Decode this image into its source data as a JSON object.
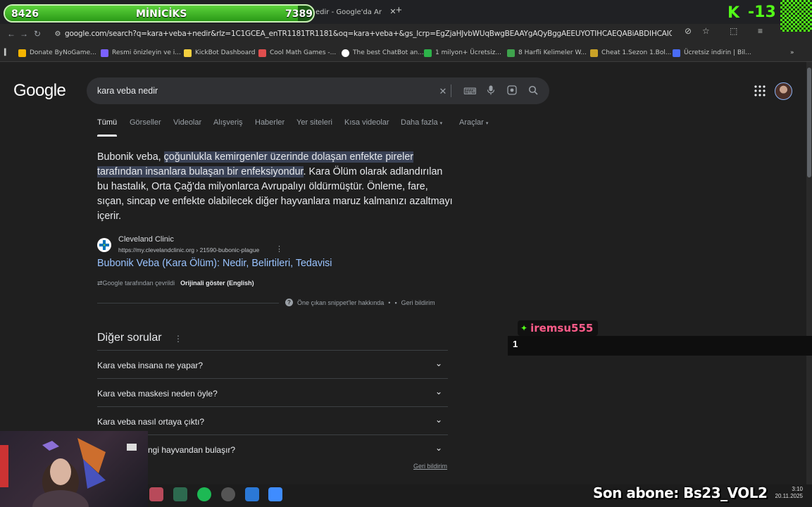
{
  "browser": {
    "tab_title": "edir - Google'da Ar",
    "url": "google.com/search?q=kara+veba+nedir&rlz=1C1GCEA_enTR1181TR1181&oq=kara+veba+&gs_lcrp=EgZjaHJvbWUqBwgBEAAYgAQyBggAEEUYOTIHCAEQABiABDIHCAIQABiABDIH...",
    "bookmarks": [
      {
        "label": "Donate ByNoGame...",
        "icon": "nogame-icon",
        "color": "#f4b400"
      },
      {
        "label": "Resmi önizleyin ve i...",
        "icon": "rp-icon",
        "color": "#7b61ff"
      },
      {
        "label": "KickBot Dashboard",
        "icon": "kickbot-icon",
        "color": "#f4d03f"
      },
      {
        "label": "Cool Math Games -...",
        "icon": "coolmath-icon",
        "color": "#e04e4e"
      },
      {
        "label": "The best ChatBot an...",
        "icon": "chatbot-icon",
        "color": "#ffffff"
      },
      {
        "label": "1 milyon+ Ücretsiz...",
        "icon": "px-icon",
        "color": "#2db34a"
      },
      {
        "label": "8 Harfli Kelimeler W...",
        "icon": "w-icon",
        "color": "#3fa34d"
      },
      {
        "label": "Cheat 1.Sezon 1.Bol...",
        "icon": "cheat-icon",
        "color": "#c9a227"
      },
      {
        "label": "Ücretsiz indirin | Bil...",
        "icon": "freepik-icon",
        "color": "#4a6cf7"
      }
    ]
  },
  "google": {
    "logo": "Google",
    "query": "kara veba nedir",
    "tabs": [
      "Tümü",
      "Görseller",
      "Videolar",
      "Alışveriş",
      "Haberler",
      "Yer siteleri",
      "Kısa videolar",
      "Daha fazla",
      "Araçlar"
    ],
    "snippet": {
      "before": "Bubonik veba, ",
      "highlight": "çoğunlukla kemirgenler üzerinde dolaşan enfekte pireler tarafından insanlara bulaşan bir enfeksiyondur",
      "after": ". Kara Ölüm olarak adlandırılan bu hastalık, Orta Çağ'da milyonlarca Avrupalıyı öldürmüştür. Önleme, fare, sıçan, sincap ve enfekte olabilecek diğer hayvanlara maruz kalmanızı azaltmayı içerir."
    },
    "source": {
      "name": "Cleveland Clinic",
      "url": "https://my.clevelandclinic.org › 21590-bubonic-plague",
      "title": "Bubonik Veba (Kara Ölüm): Nedir, Belirtileri, Tedavisi"
    },
    "translated_note": "Google tarafından çevrildi",
    "show_original": "Orijinali göster (English)",
    "about_snippets": "Öne çıkan snippet'ler hakkında",
    "feedback": "Geri bildirim",
    "paa_title": "Diğer sorular",
    "paa_questions": [
      "Kara veba insana ne yapar?",
      "Kara veba maskesi neden öyle?",
      "Kara veba nasıl ortaya çıktı?",
      "Kara veba hangi hayvandan bulaşır?"
    ],
    "paa_question_4_visible": "ngi hayvandan bulaşır?"
  },
  "overlay": {
    "progress_left": "8426",
    "progress_label": "MİNİCİKS",
    "progress_right": "7389",
    "progress_fraction": 0.95,
    "kick_count": "13",
    "chat_username": "iremsu555",
    "chat_message": "1",
    "subscriber": "Son abone: Bs23_VOL2",
    "clock_time": "3:10",
    "clock_date": "20.11.2025"
  }
}
